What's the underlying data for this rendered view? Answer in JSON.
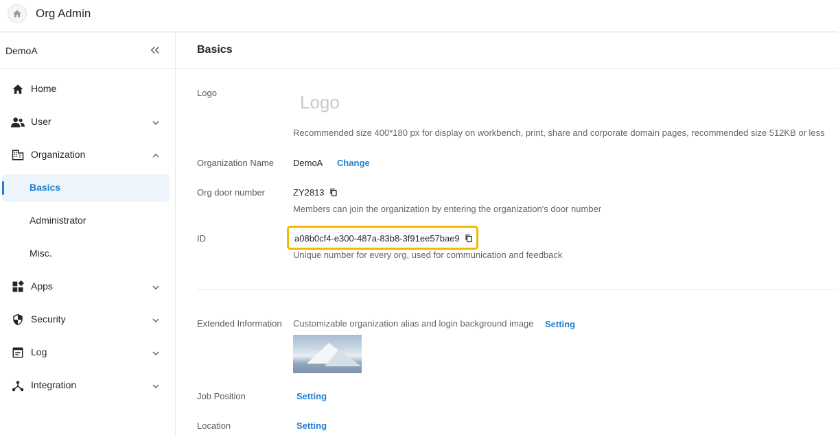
{
  "app": {
    "title": "Org Admin"
  },
  "sidebar": {
    "org_name": "DemoA",
    "items": [
      {
        "label": "Home"
      },
      {
        "label": "User"
      },
      {
        "label": "Organization"
      },
      {
        "label": "Apps"
      },
      {
        "label": "Security"
      },
      {
        "label": "Log"
      },
      {
        "label": "Integration"
      }
    ],
    "org_sub": [
      {
        "label": "Basics"
      },
      {
        "label": "Administrator"
      },
      {
        "label": "Misc."
      }
    ]
  },
  "main": {
    "title": "Basics",
    "logo": {
      "label": "Logo",
      "placeholder": "Logo",
      "hint": "Recommended size 400*180 px for display on workbench, print, share and corporate domain pages, recommended size 512KB or less"
    },
    "org_name": {
      "label": "Organization Name",
      "value": "DemoA",
      "action": "Change"
    },
    "door_number": {
      "label": "Org door number",
      "value": "ZY2813",
      "hint": "Members can join the organization by entering the organization's door number"
    },
    "id": {
      "label": "ID",
      "value": "a08b0cf4-e300-487a-83b8-3f91ee57bae9",
      "hint": "Unique number for every org, used for communication and feedback"
    },
    "extended": {
      "label": "Extended Information",
      "text": "Customizable organization alias and login background image",
      "action": "Setting"
    },
    "job_position": {
      "label": "Job Position",
      "action": "Setting"
    },
    "location": {
      "label": "Location",
      "action": "Setting"
    }
  },
  "colors": {
    "accent": "#1f7fd3",
    "highlight": "#f2b800",
    "active_bg": "#eef4fb"
  }
}
